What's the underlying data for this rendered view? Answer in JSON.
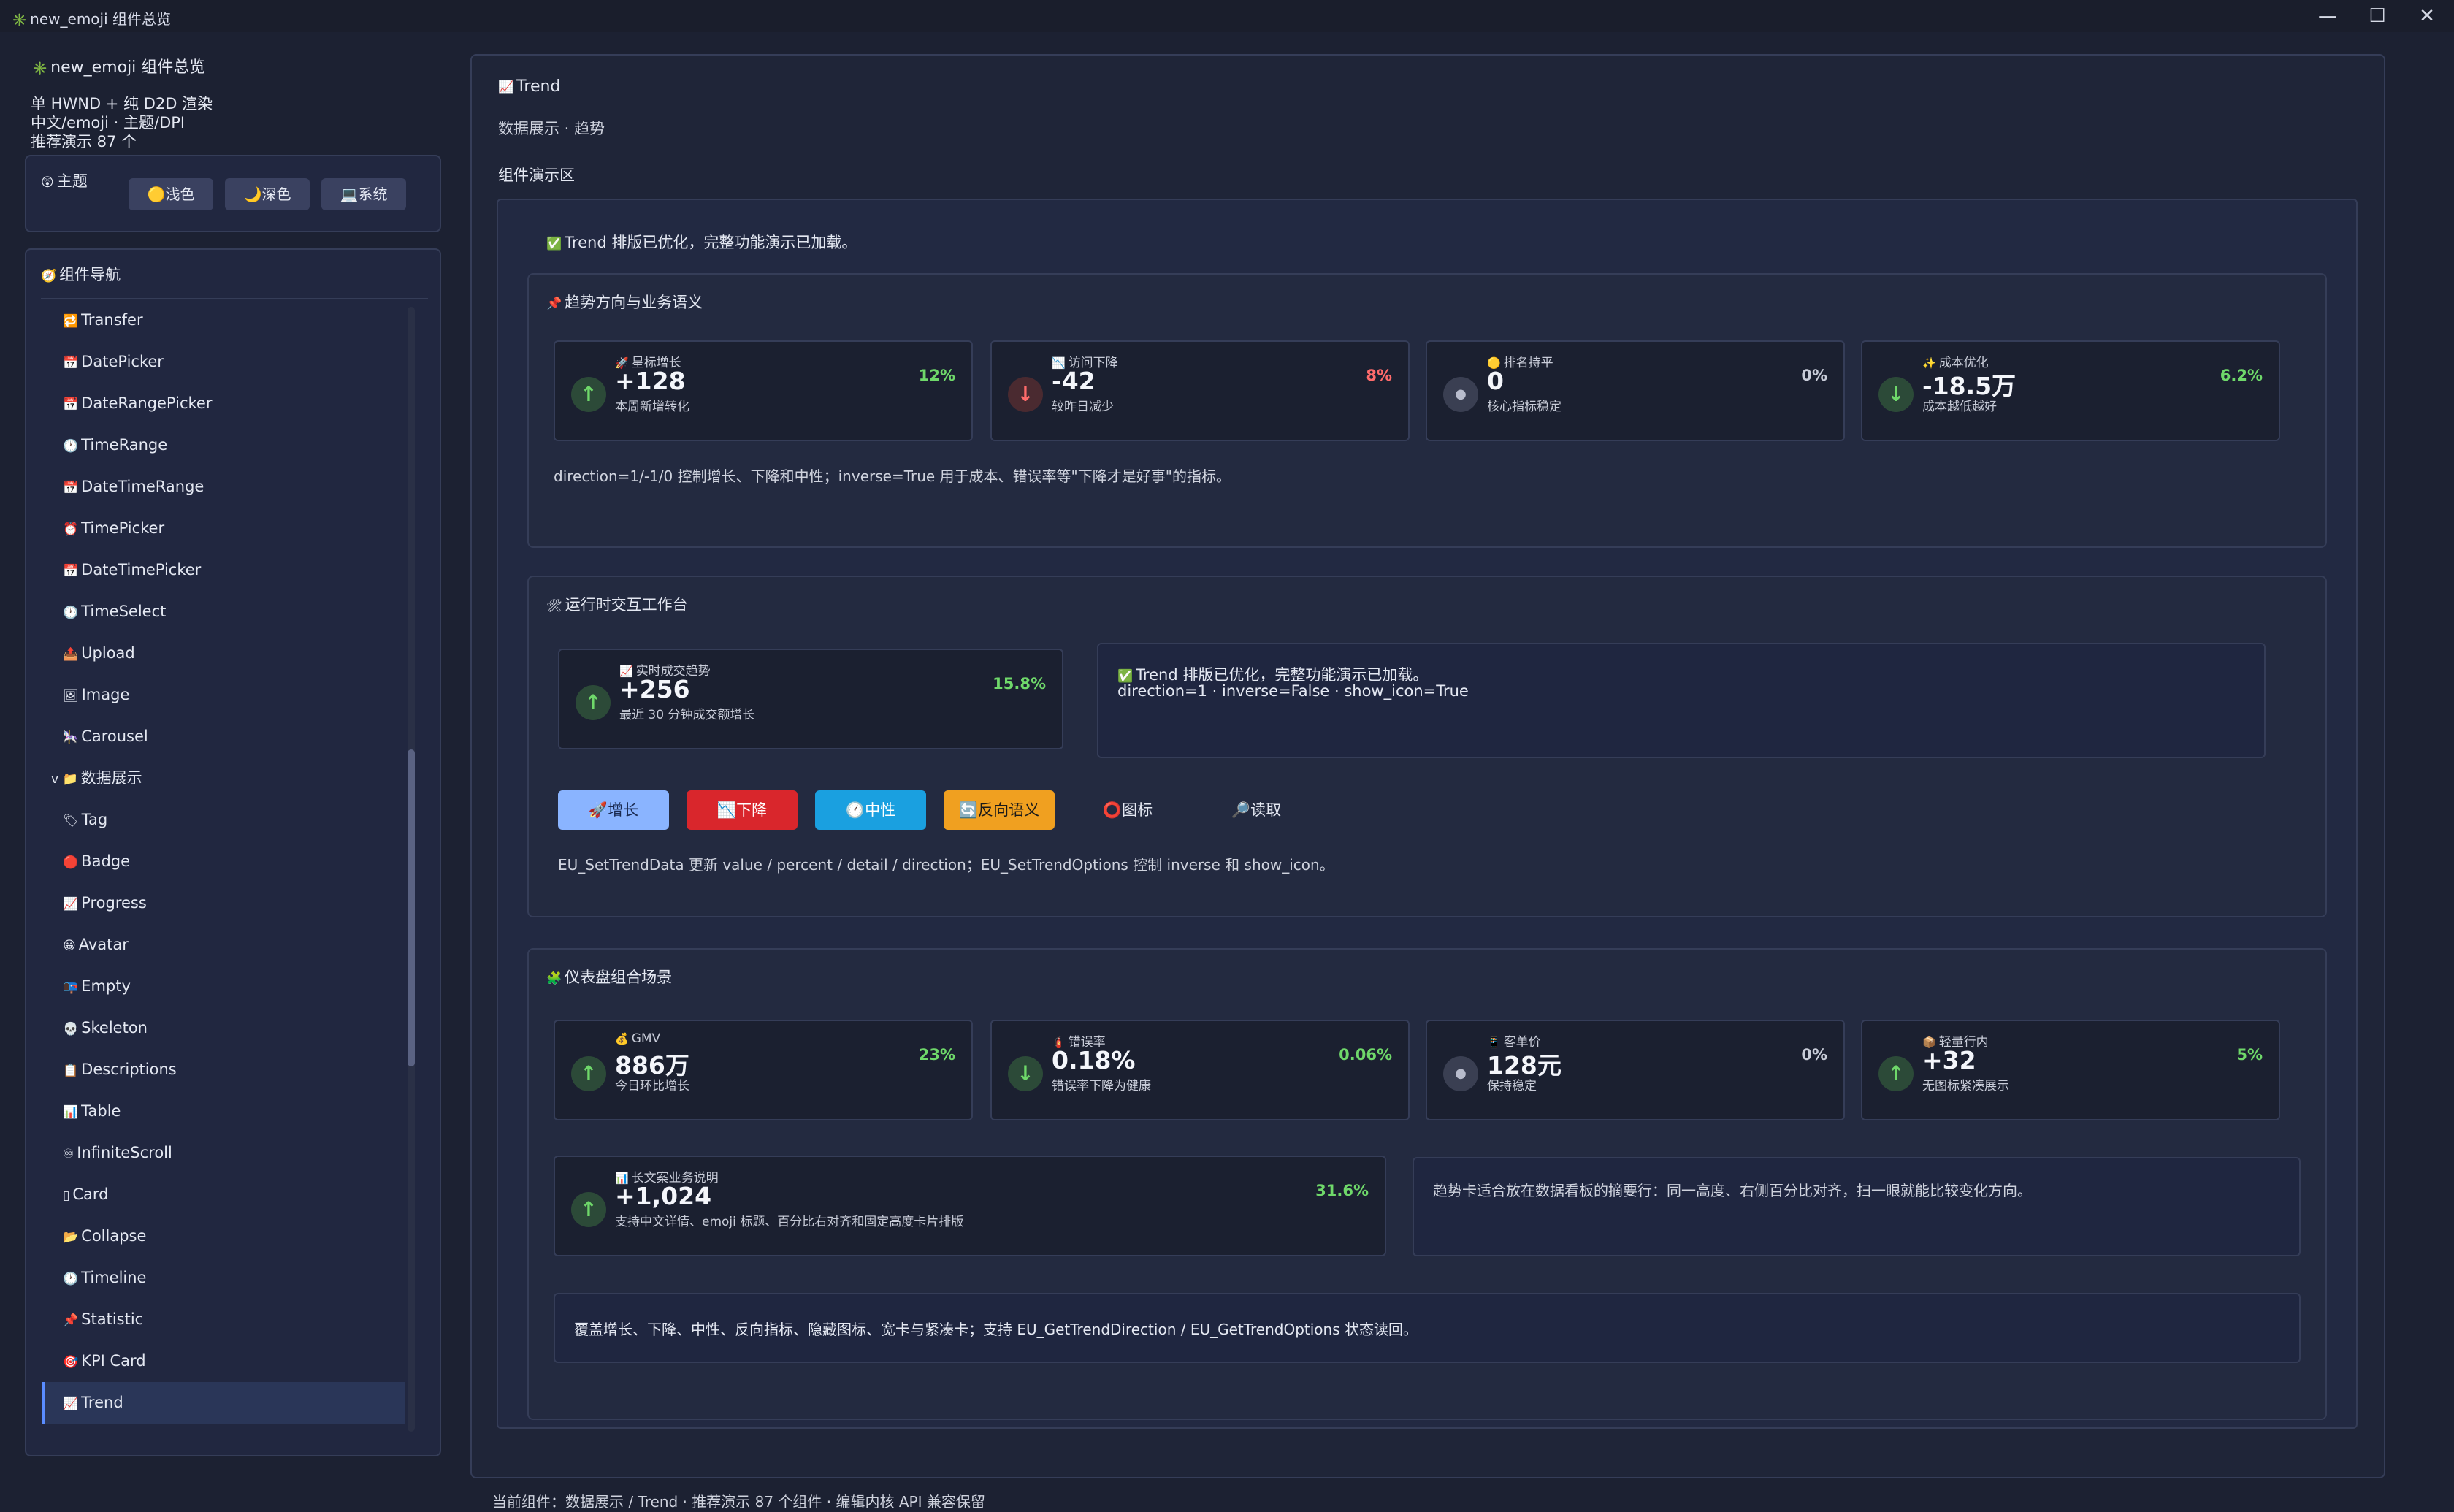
{
  "window": {
    "title": "new_emoji 组件总览",
    "minimize": "—",
    "maximize": "☐",
    "close": "✕"
  },
  "sidebar": {
    "app_title": "new_emoji 组件总览",
    "info_line1": "单 HWND + 纯 D2D 渲染",
    "info_line2": "中文/emoji · 主题/DPI",
    "info_line3": "推荐演示 87 个",
    "theme_label": "主题",
    "theme_buttons": [
      "🟡浅色",
      "🌙深色",
      "💻系统"
    ],
    "nav_title": "组件导航",
    "nav_items": [
      {
        "icon": "🔁",
        "label": "Transfer"
      },
      {
        "icon": "📅",
        "label": "DatePicker"
      },
      {
        "icon": "📅",
        "label": "DateRangePicker"
      },
      {
        "icon": "🕐",
        "label": "TimeRange"
      },
      {
        "icon": "📅",
        "label": "DateTimeRange"
      },
      {
        "icon": "⏰",
        "label": "TimePicker"
      },
      {
        "icon": "📅",
        "label": "DateTimePicker"
      },
      {
        "icon": "🕐",
        "label": "TimeSelect"
      },
      {
        "icon": "📤",
        "label": "Upload"
      },
      {
        "icon": "🖼",
        "label": "Image"
      },
      {
        "icon": "🎠",
        "label": "Carousel"
      },
      {
        "icon": "v 📁",
        "label": "数据展示"
      },
      {
        "icon": "🏷",
        "label": "Tag"
      },
      {
        "icon": "🔴",
        "label": "Badge"
      },
      {
        "icon": "📈",
        "label": "Progress"
      },
      {
        "icon": "😀",
        "label": "Avatar"
      },
      {
        "icon": "📭",
        "label": "Empty"
      },
      {
        "icon": "💀",
        "label": "Skeleton"
      },
      {
        "icon": "📋",
        "label": "Descriptions"
      },
      {
        "icon": "📊",
        "label": "Table"
      },
      {
        "icon": "♾",
        "label": "InfiniteScroll"
      },
      {
        "icon": "▯",
        "label": "Card"
      },
      {
        "icon": "📂",
        "label": "Collapse"
      },
      {
        "icon": "🕐",
        "label": "Timeline"
      },
      {
        "icon": "📌",
        "label": "Statistic"
      },
      {
        "icon": "🎯",
        "label": "KPI Card"
      },
      {
        "icon": "📈",
        "label": "Trend"
      }
    ]
  },
  "main": {
    "title": "Trend",
    "subtitle": "数据展示 · 趋势",
    "demo_label": "组件演示区",
    "status_banner": "Trend 排版已优化，完整功能演示已加载。",
    "section1": {
      "title": "趋势方向与业务语义",
      "cards": [
        {
          "icon": "🚀",
          "label": "星标增长",
          "value": "+128",
          "detail": "本周新增转化",
          "percent": "12%"
        },
        {
          "icon": "📉",
          "label": "访问下降",
          "value": "-42",
          "detail": "较昨日减少",
          "percent": "8%"
        },
        {
          "icon": "🟡",
          "label": "排名持平",
          "value": "0",
          "detail": "核心指标稳定",
          "percent": "0%"
        },
        {
          "icon": "✨",
          "label": "成本优化",
          "value": "-18.5万",
          "detail": "成本越低越好",
          "percent": "6.2%"
        }
      ],
      "note": "direction=1/-1/0 控制增长、下降和中性；inverse=True 用于成本、错误率等\"下降才是好事\"的指标。"
    },
    "section2": {
      "title": "运行时交互工作台",
      "card": {
        "icon": "📈",
        "label": "实时成交趋势",
        "value": "+256",
        "detail": "最近 30 分钟成交额增长",
        "percent": "15.8%"
      },
      "status_line1": "Trend 排版已优化，完整功能演示已加载。",
      "status_line2": "direction=1 · inverse=False · show_icon=True",
      "buttons": [
        "🚀增长",
        "📉下降",
        "🕐中性",
        "🔄反向语义",
        "⭕图标",
        "🔎读取"
      ],
      "note": "EU_SetTrendData 更新 value / percent / detail / direction；EU_SetTrendOptions 控制 inverse 和 show_icon。"
    },
    "section3": {
      "title": "仪表盘组合场景",
      "cards": [
        {
          "icon": "💰",
          "label": "GMV",
          "value": "886万",
          "detail": "今日环比增长",
          "percent": "23%"
        },
        {
          "icon": "🧯",
          "label": "错误率",
          "value": "0.18%",
          "detail": "错误率下降为健康",
          "percent": "0.06%"
        },
        {
          "icon": "📱",
          "label": "客单价",
          "value": "128元",
          "detail": "保持稳定",
          "percent": "0%"
        },
        {
          "icon": "📦",
          "label": "轻量行内",
          "value": "+32",
          "detail": "无图标紧凑展示",
          "percent": "5%"
        }
      ],
      "wide_card": {
        "icon": "📊",
        "label": "长文案业务说明",
        "value": "+1,024",
        "detail": "支持中文详情、emoji 标题、百分比右对齐和固定高度卡片排版",
        "percent": "31.6%"
      },
      "side_note": "趋势卡适合放在数据看板的摘要行：同一高度、右侧百分比对齐，扫一眼就能比较变化方向。",
      "footer_note": "覆盖增长、下降、中性、反向指标、隐藏图标、宽卡与紧凑卡；支持 EU_GetTrendDirection / EU_GetTrendOptions 状态读回。"
    },
    "status_bar": "当前组件：数据展示 / Trend · 推荐演示 87 个组件 · 编辑内核 API 兼容保留"
  },
  "colors": {
    "background": "#1c2132",
    "panel": "#212740",
    "accent": "#5a8cff",
    "up": "#6fd86a",
    "down": "#ff6b6b",
    "btn_up": "#8ab4ff",
    "btn_down": "#d9262c",
    "btn_neutral": "#1aa0e0",
    "btn_inverse": "#f0a020"
  }
}
